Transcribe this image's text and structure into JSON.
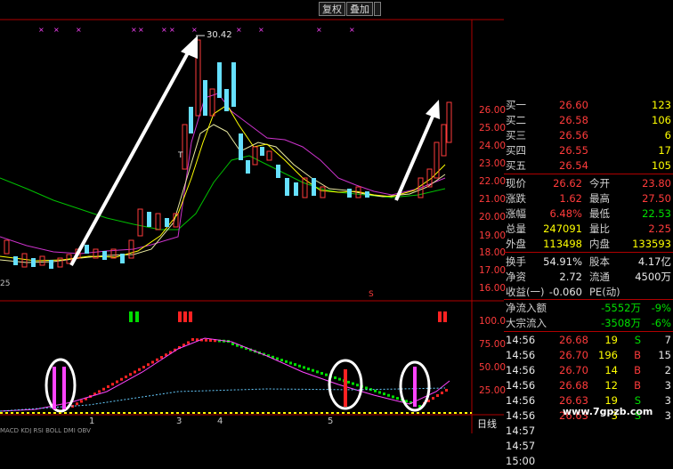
{
  "toolbar": {
    "restore_label": "复权",
    "overlay_label": "叠加"
  },
  "chart": {
    "peak_label": "30.42",
    "left_label": "25",
    "t_marker": "T",
    "s_marker": "S",
    "price_axis": [
      "26.00",
      "25.00",
      "24.00",
      "23.00",
      "22.00",
      "21.00",
      "20.00",
      "19.00",
      "18.00",
      "17.00",
      "16.00"
    ],
    "osc_axis": [
      "100.0",
      "75.00",
      "50.00",
      "25.00"
    ],
    "x_ticks": [
      "1",
      "3",
      "4",
      "5"
    ],
    "period_label": "日线",
    "bottom_tabs": "MACD KDJ RSI BOLL DMI OBV"
  },
  "quote": {
    "bids": [
      {
        "label": "买一",
        "price": "26.60",
        "vol": "123"
      },
      {
        "label": "买二",
        "price": "26.58",
        "vol": "106"
      },
      {
        "label": "买三",
        "price": "26.56",
        "vol": "6"
      },
      {
        "label": "买四",
        "price": "26.55",
        "vol": "17"
      },
      {
        "label": "买五",
        "price": "26.54",
        "vol": "105"
      }
    ],
    "stats": [
      {
        "l1": "现价",
        "v1": "26.62",
        "l2": "今开",
        "v2": "23.80"
      },
      {
        "l1": "涨跌",
        "v1": "1.62",
        "l2": "最高",
        "v2": "27.50"
      },
      {
        "l1": "涨幅",
        "v1": "6.48%",
        "l2": "最低",
        "v2": "22.53"
      },
      {
        "l1": "总量",
        "v1": "247091",
        "l2": "量比",
        "v2": "2.25"
      },
      {
        "l1": "外盘",
        "v1": "113498",
        "l2": "内盘",
        "v2": "133593"
      }
    ],
    "fund": [
      {
        "l1": "换手",
        "v1": "54.91%",
        "l2": "股本",
        "v2": "4.17亿"
      },
      {
        "l1": "净资",
        "v1": "2.72",
        "l2": "流通",
        "v2": "4500万"
      },
      {
        "l1": "收益(一)",
        "v1": "-0.060",
        "l2": "PE(动)",
        "v2": ""
      }
    ],
    "flow": [
      {
        "label": "净流入额",
        "value": "-5552万",
        "pct": "-9%"
      },
      {
        "label": "大宗流入",
        "value": "-3508万",
        "pct": "-6%"
      }
    ],
    "ticks": [
      {
        "time": "14:56",
        "price": "26.68",
        "vol": "19",
        "side": "S",
        "n": "7"
      },
      {
        "time": "14:56",
        "price": "26.70",
        "vol": "196",
        "side": "B",
        "n": "15"
      },
      {
        "time": "14:56",
        "price": "26.70",
        "vol": "14",
        "side": "B",
        "n": "2"
      },
      {
        "time": "14:56",
        "price": "26.68",
        "vol": "12",
        "side": "B",
        "n": "3"
      },
      {
        "time": "14:56",
        "price": "26.63",
        "vol": "19",
        "side": "S",
        "n": "3"
      },
      {
        "time": "14:56",
        "price": "26.63",
        "vol": "3",
        "side": "S",
        "n": "3"
      },
      {
        "time": "14:57",
        "price": "",
        "vol": "",
        "side": "",
        "n": ""
      },
      {
        "time": "14:57",
        "price": "",
        "vol": "",
        "side": "",
        "n": ""
      },
      {
        "time": "15:00",
        "price": "",
        "vol": "",
        "side": "",
        "n": ""
      }
    ],
    "watermark": "www.7gpzb.com"
  }
}
